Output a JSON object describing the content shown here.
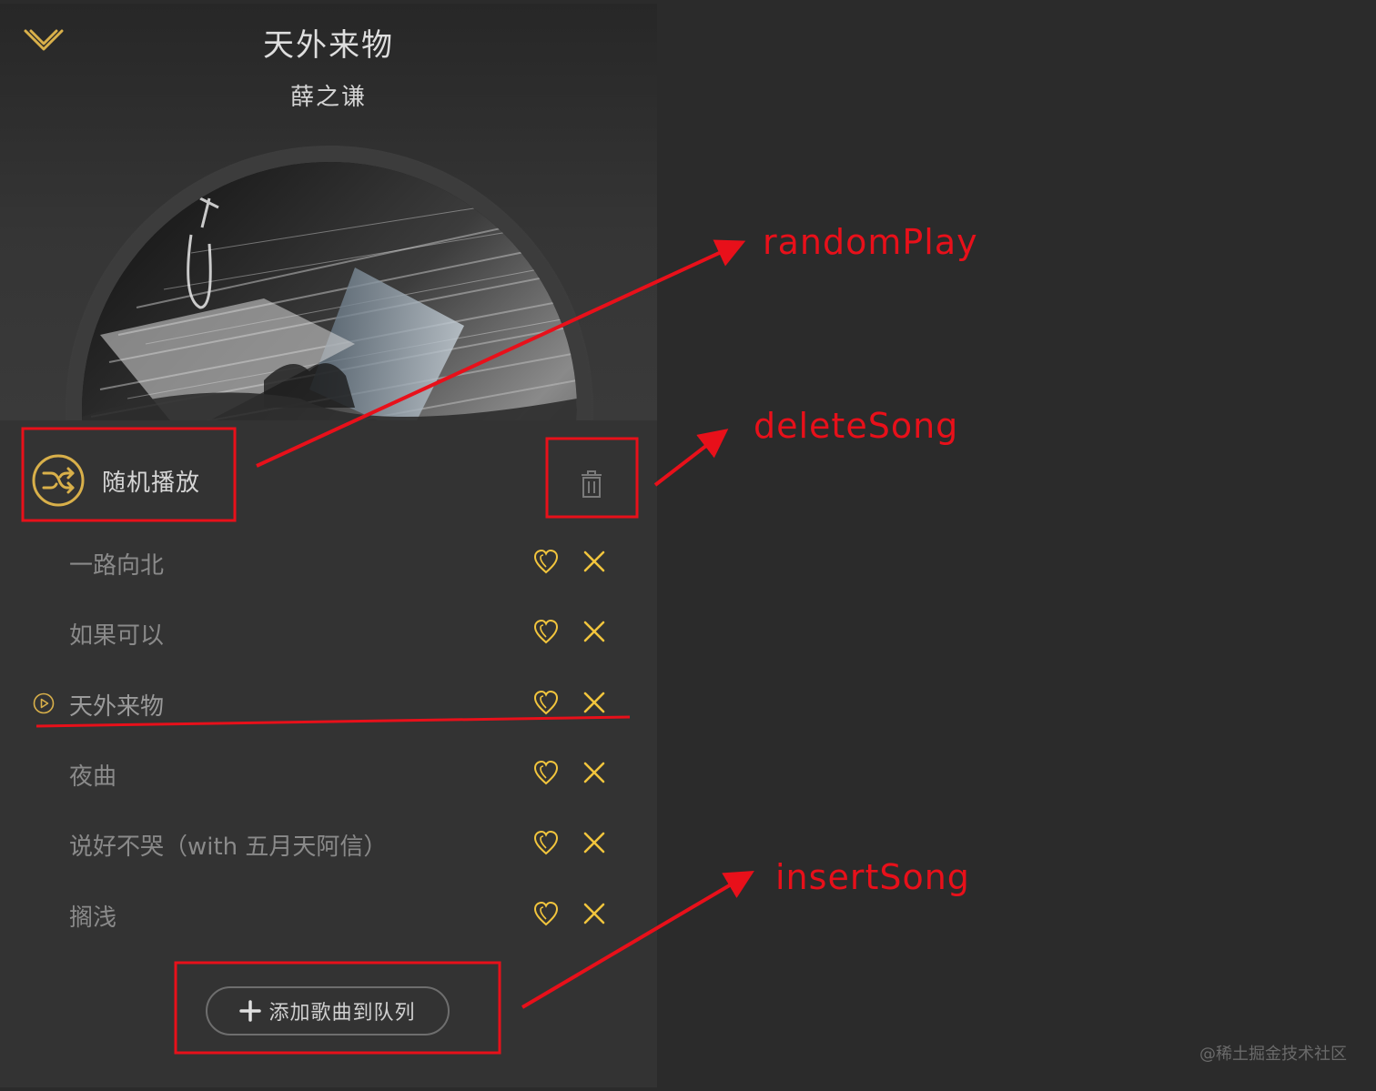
{
  "player": {
    "song_title": "天外来物",
    "artist": "薛之谦"
  },
  "controls": {
    "random_play_label": "随机播放",
    "add_to_queue_label": "添加歌曲到队列"
  },
  "playlist": [
    {
      "name": "一路向北",
      "current": false
    },
    {
      "name": "如果可以",
      "current": false
    },
    {
      "name": "天外来物",
      "current": true
    },
    {
      "name": "夜曲",
      "current": false
    },
    {
      "name": "说好不哭（with 五月天阿信）",
      "current": false
    },
    {
      "name": "搁浅",
      "current": false
    }
  ],
  "annotations": {
    "random_play": "randomPlay",
    "delete_song": "deleteSong",
    "insert_song": "insertSong"
  },
  "watermark": "@稀土掘金技术社区",
  "colors": {
    "accent_gold": "#d9b04a",
    "icon_yellow": "#f2c53d",
    "annotation_red": "#e8101a",
    "panel_bg": "#333333",
    "page_bg": "#2b2b2b"
  },
  "icons": {
    "collapse": "chevron-down-icon",
    "shuffle": "shuffle-icon",
    "trash": "trash-icon",
    "favorite": "heart-icon",
    "remove": "close-icon",
    "now_playing": "play-circle-icon",
    "add": "plus-icon"
  }
}
